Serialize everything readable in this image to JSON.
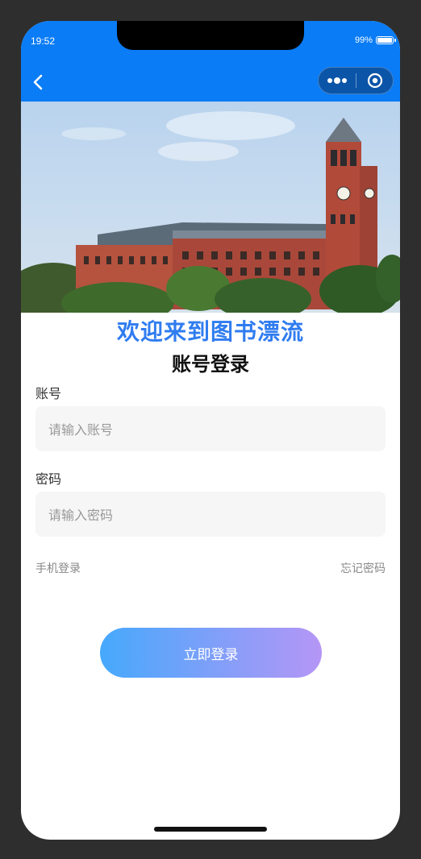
{
  "status": {
    "time": "19:52",
    "battery": "99%"
  },
  "colors": {
    "nav": "#0a7cf6",
    "accent": "#2f7cf0",
    "btn_start": "#46a9fc",
    "btn_end": "#b596f6"
  },
  "icons": {
    "back": "chevron-left-icon",
    "more": "more-dots-icon",
    "close": "target-close-icon"
  },
  "welcome": "欢迎来到图书漂流",
  "subtitle": "账号登录",
  "account": {
    "label": "账号",
    "placeholder": "请输入账号",
    "value": ""
  },
  "password": {
    "label": "密码",
    "placeholder": "请输入密码",
    "value": ""
  },
  "links": {
    "phone_login": "手机登录",
    "forgot": "忘记密码"
  },
  "login_button": "立即登录"
}
